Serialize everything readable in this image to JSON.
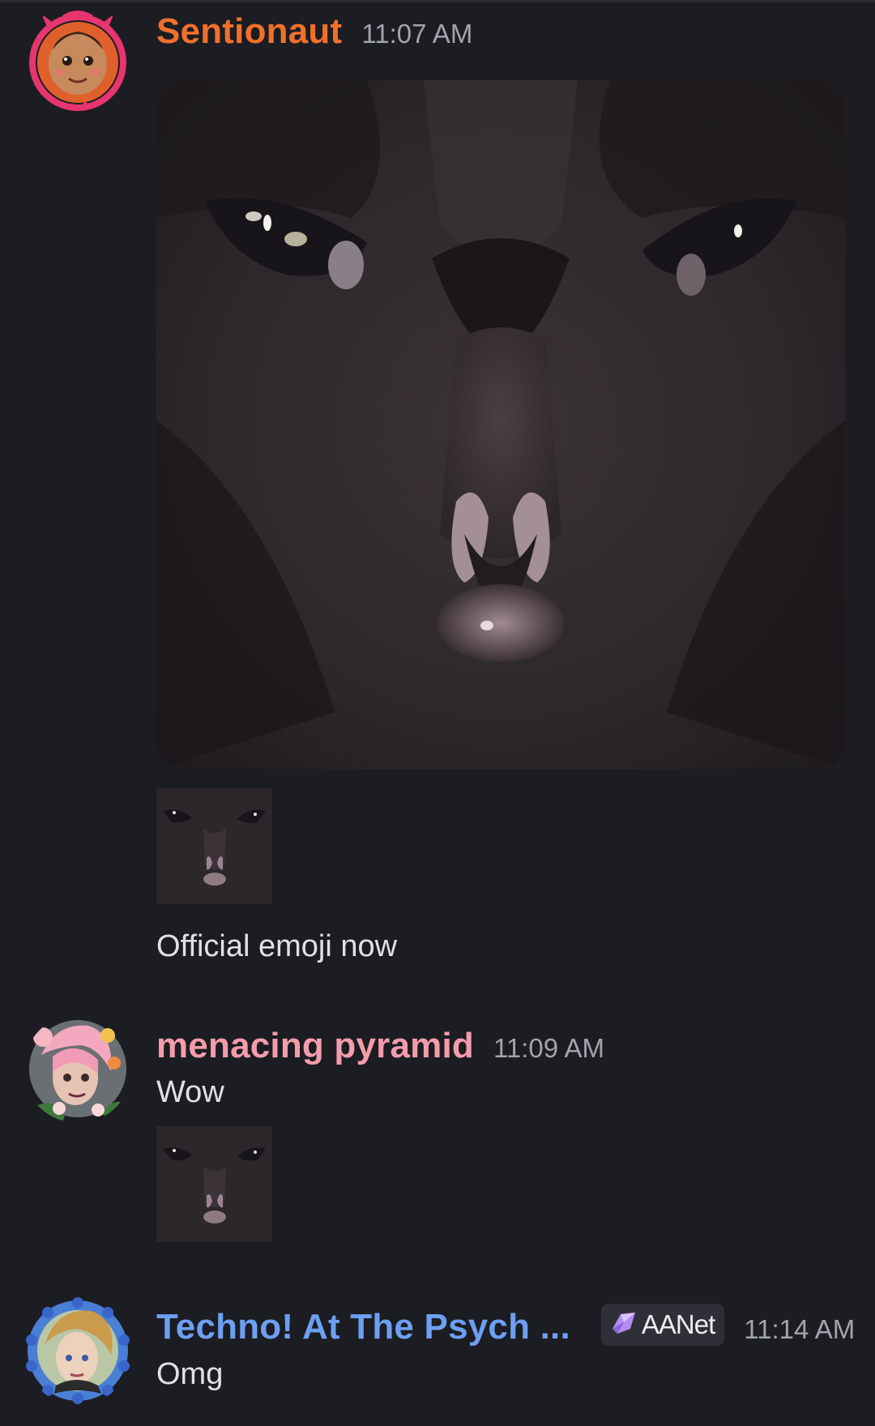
{
  "messages": [
    {
      "username": "Sentionaut",
      "username_color": "#f0702b",
      "timestamp": "11:07 AM",
      "attachments": [
        "cat-face-image",
        "cat-face-emoji"
      ],
      "text": "Official emoji now"
    },
    {
      "username": "menacing pyramid",
      "username_color": "#f49cab",
      "timestamp": "11:09 AM",
      "text": "Wow",
      "attachments": [
        "cat-face-emoji"
      ]
    },
    {
      "username": "Techno! At The Psych ...",
      "username_color": "#6d9ff2",
      "role_tag": {
        "icon": "crystal-icon",
        "label": "AANet"
      },
      "timestamp": "11:14 AM",
      "text": "Omg"
    }
  ]
}
